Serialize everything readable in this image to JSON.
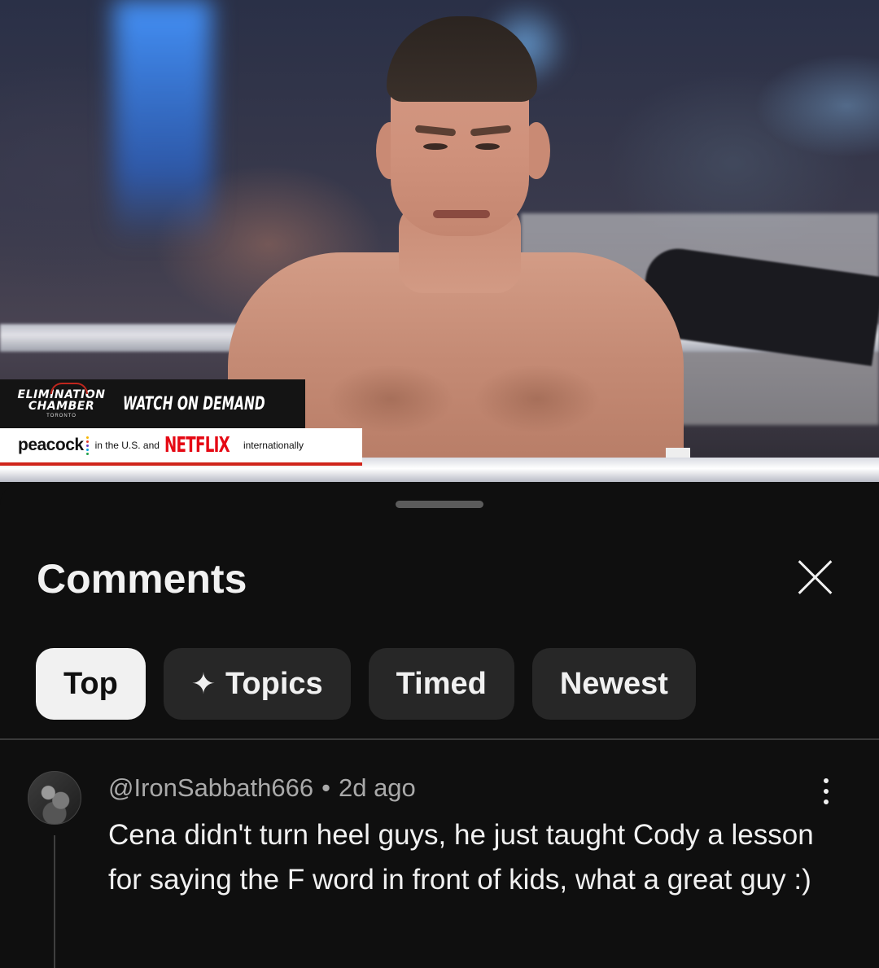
{
  "video": {
    "promo": {
      "event_logo_line1": "ELIMINATION",
      "event_logo_line2": "CHAMBER",
      "event_logo_line3": "TORONTO",
      "headline": "WATCH ON DEMAND",
      "streamer_us": "peacock",
      "streamer_us_suffix": "in the U.S. and",
      "streamer_intl": "NETFLIX",
      "streamer_intl_suffix": "internationally"
    }
  },
  "comments_panel": {
    "title": "Comments",
    "close_icon": "close-icon",
    "chips": [
      {
        "label": "Top",
        "selected": true
      },
      {
        "label": "Topics",
        "icon": "sparkle-icon"
      },
      {
        "label": "Timed"
      },
      {
        "label": "Newest"
      }
    ],
    "comments": [
      {
        "author": "@IronSabbath666",
        "separator": "•",
        "time": "2d ago",
        "text": "Cena didn't turn heel guys, he just taught Cody a lesson for saying the F word in front of kids, what a great guy :)",
        "menu_icon": "more-vert-icon"
      }
    ]
  },
  "colors": {
    "background": "#0f0f0f",
    "chip": "#272727",
    "chip_selected": "#f1f1f1",
    "text_primary": "#f1f1f1",
    "text_secondary": "#aaaaaa",
    "netflix_red": "#e50914"
  }
}
